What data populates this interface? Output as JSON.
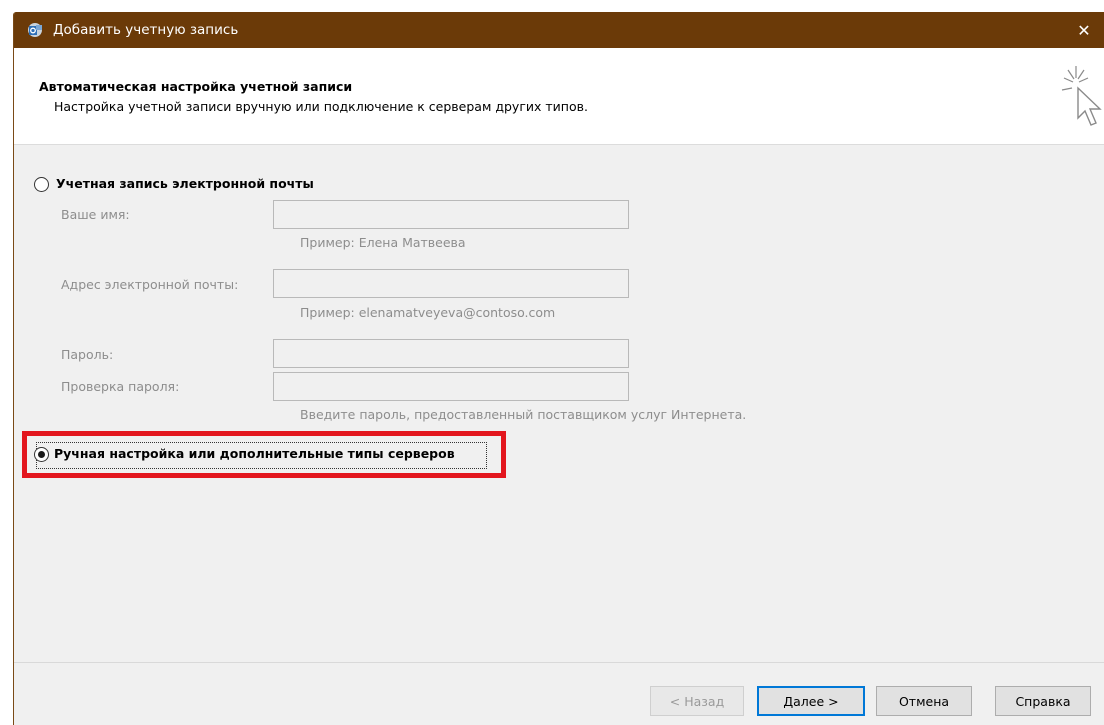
{
  "window": {
    "title": "Добавить учетную запись",
    "close_glyph": "✕"
  },
  "header": {
    "title": "Автоматическая настройка учетной записи",
    "subtitle": "Настройка учетной записи вручную или подключение к серверам других типов."
  },
  "options": {
    "email_account": {
      "label": "Учетная запись электронной почты",
      "selected": false
    },
    "manual_setup": {
      "label": "Ручная настройка или дополнительные типы серверов",
      "selected": true
    }
  },
  "form": {
    "name_label": "Ваше имя:",
    "name_value": "",
    "name_hint": "Пример: Елена Матвеева",
    "email_label": "Адрес электронной почты:",
    "email_value": "",
    "email_hint": "Пример: elenamatveyeva@contoso.com",
    "password_label": "Пароль:",
    "password_value": "",
    "password_confirm_label": "Проверка пароля:",
    "password_confirm_value": "",
    "password_hint": "Введите пароль, предоставленный поставщиком услуг Интернета."
  },
  "buttons": {
    "back": "< Назад",
    "next": "Далее >",
    "cancel": "Отмена",
    "help": "Справка"
  },
  "colors": {
    "titlebar": "#6b3a08",
    "highlight": "#e3161e",
    "default_button_border": "#0078d7"
  },
  "icons": {
    "app": "outlook-app-icon",
    "wizard": "wizard-cursor-sparkle-icon",
    "close": "close-icon"
  }
}
